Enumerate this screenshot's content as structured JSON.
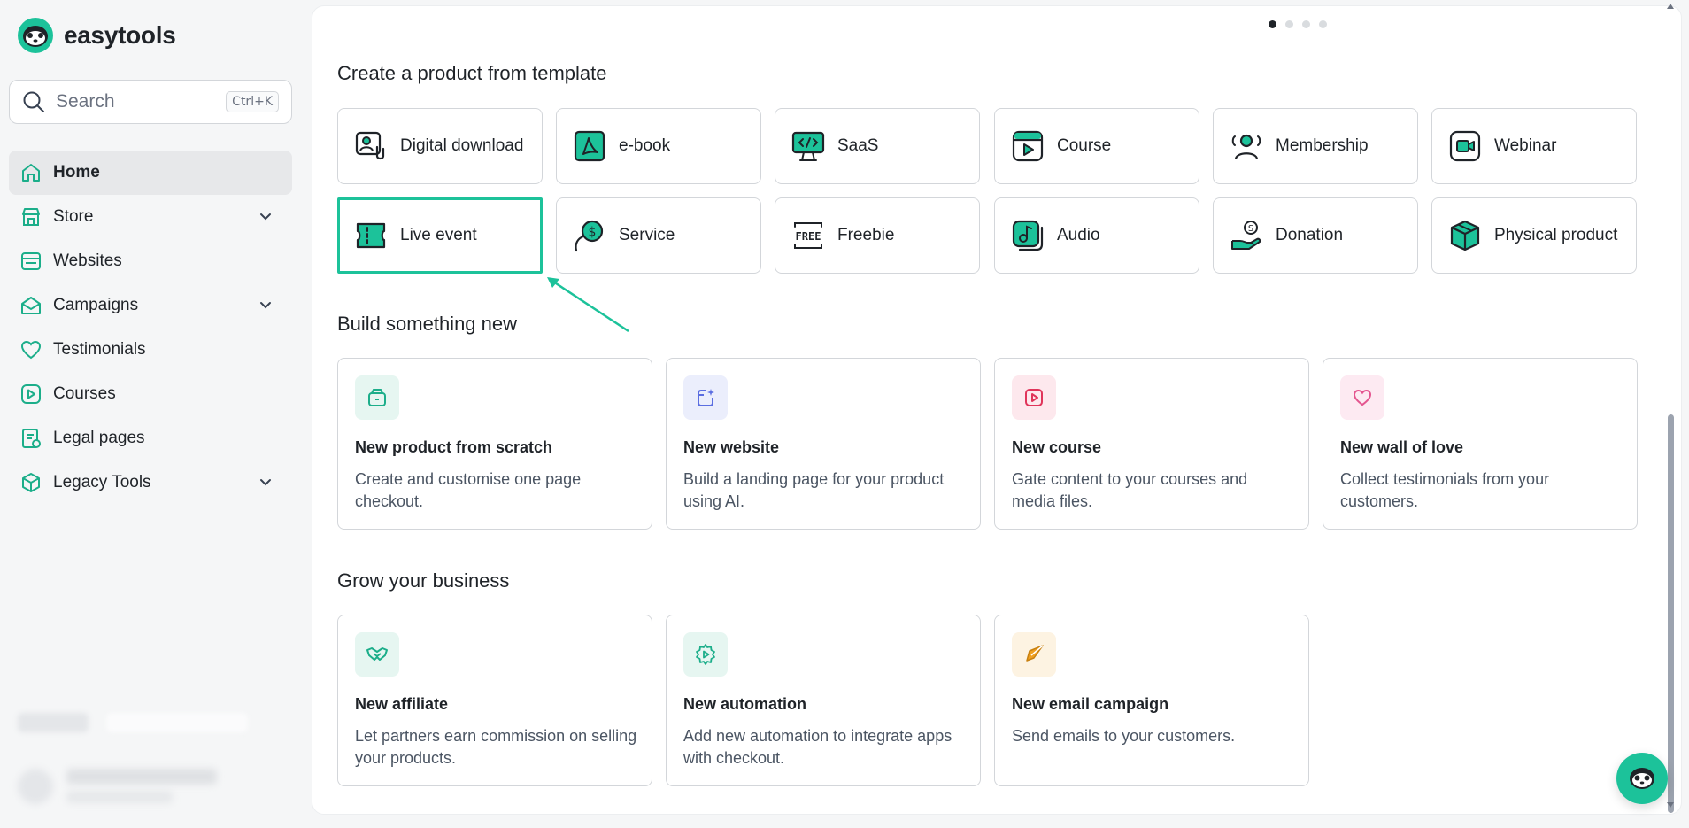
{
  "brand": {
    "name": "easytools"
  },
  "search": {
    "placeholder": "Search",
    "shortcut": "Ctrl+K"
  },
  "sidebar": {
    "items": [
      {
        "label": "Home",
        "icon": "home-icon",
        "active": true,
        "expandable": false
      },
      {
        "label": "Store",
        "icon": "store-icon",
        "active": false,
        "expandable": true
      },
      {
        "label": "Websites",
        "icon": "websites-icon",
        "active": false,
        "expandable": false
      },
      {
        "label": "Campaigns",
        "icon": "campaigns-icon",
        "active": false,
        "expandable": true
      },
      {
        "label": "Testimonials",
        "icon": "heart-icon",
        "active": false,
        "expandable": false
      },
      {
        "label": "Courses",
        "icon": "play-icon",
        "active": false,
        "expandable": false
      },
      {
        "label": "Legal pages",
        "icon": "legal-icon",
        "active": false,
        "expandable": false
      },
      {
        "label": "Legacy Tools",
        "icon": "box-icon",
        "active": false,
        "expandable": true
      }
    ]
  },
  "carousel": {
    "pages": 4,
    "current": 1
  },
  "templates": {
    "title": "Create a product from template",
    "items": [
      {
        "label": "Digital download",
        "icon": "digital-download-icon"
      },
      {
        "label": "e-book",
        "icon": "ebook-icon"
      },
      {
        "label": "SaaS",
        "icon": "saas-icon"
      },
      {
        "label": "Course",
        "icon": "course-icon"
      },
      {
        "label": "Membership",
        "icon": "membership-icon"
      },
      {
        "label": "Webinar",
        "icon": "webinar-icon"
      },
      {
        "label": "Live event",
        "icon": "ticket-icon",
        "highlighted": true
      },
      {
        "label": "Service",
        "icon": "service-icon"
      },
      {
        "label": "Freebie",
        "icon": "free-icon",
        "icon_text": "FREE"
      },
      {
        "label": "Audio",
        "icon": "audio-icon"
      },
      {
        "label": "Donation",
        "icon": "donation-icon"
      },
      {
        "label": "Physical product",
        "icon": "physical-product-icon"
      }
    ]
  },
  "build": {
    "title": "Build something new",
    "items": [
      {
        "title": "New product from scratch",
        "desc": "Create and customise one page checkout.",
        "icon": "product-box-icon",
        "color": "#1cae8a",
        "bg": "#e6f6f1"
      },
      {
        "title": "New website",
        "desc": "Build a landing page for your product using AI.",
        "icon": "website-sparkle-icon",
        "color": "#5b6ee1",
        "bg": "#ebeefc"
      },
      {
        "title": "New course",
        "desc": "Gate content to your courses and media files.",
        "icon": "course-play-icon",
        "color": "#e0345a",
        "bg": "#fde8ed"
      },
      {
        "title": "New wall of love",
        "desc": "Collect testimonials from your customers.",
        "icon": "heart-icon",
        "color": "#e4558f",
        "bg": "#fdeaf2"
      }
    ]
  },
  "grow": {
    "title": "Grow your business",
    "items": [
      {
        "title": "New affiliate",
        "desc": "Let partners earn commission on selling your products.",
        "icon": "handshake-icon",
        "color": "#1cae8a",
        "bg": "#e6f6f1"
      },
      {
        "title": "New automation",
        "desc": "Add new automation to integrate apps with checkout.",
        "icon": "automation-gear-icon",
        "color": "#1cae8a",
        "bg": "#e6f6f1"
      },
      {
        "title": "New email campaign",
        "desc": "Send emails to your customers.",
        "icon": "paper-plane-icon",
        "color": "#f0a020",
        "bg": "#fdf3e2"
      }
    ]
  },
  "colors": {
    "accent": "#1cc29a",
    "text": "#1f2328",
    "muted": "#4b5563"
  }
}
